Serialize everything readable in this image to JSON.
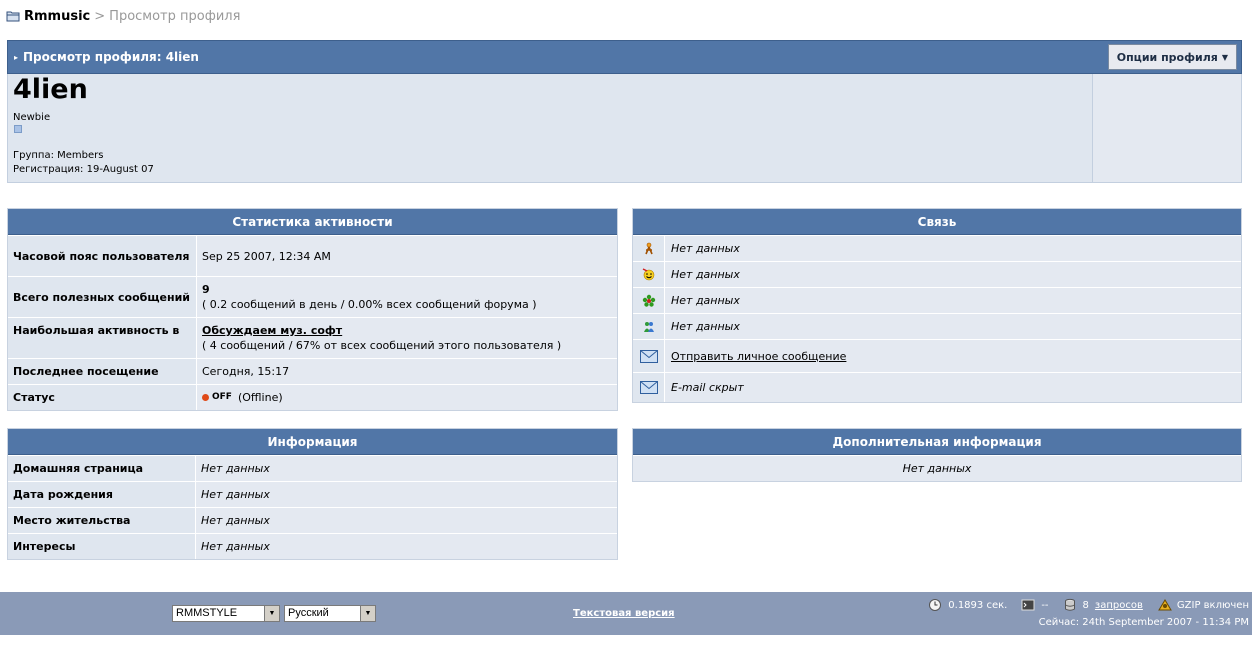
{
  "breadcrumb": {
    "home": "Rmmusic",
    "separator": ">",
    "current": "Просмотр профиля"
  },
  "header": {
    "title": "Просмотр профиля: 4lien",
    "options_label": "Опции профиля"
  },
  "profile": {
    "username": "4lien",
    "rank": "Newbie",
    "group": "Группа: Members",
    "joined": "Регистрация: 19-August 07"
  },
  "activity": {
    "title": "Статистика активности",
    "rows": [
      {
        "label": "Часовой пояс пользователя",
        "value": "Sep 25 2007, 12:34 AM"
      },
      {
        "label": "Всего полезных сообщений",
        "value": "9",
        "sub": "( 0.2 сообщений в день / 0.00% всех сообщений форума )"
      },
      {
        "label": "Наибольшая активность в",
        "value": "Обсуждаем муз. софт",
        "sub": "( 4 сообщений / 67% от всех сообщений этого пользователя )"
      },
      {
        "label": "Последнее посещение",
        "value": "Сегодня, 15:17"
      },
      {
        "label": "Статус",
        "badge": "OFF",
        "value": "(Offline)"
      }
    ]
  },
  "contact": {
    "title": "Связь",
    "rows": [
      {
        "icon": "aim-icon",
        "value": "Нет данных"
      },
      {
        "icon": "yahoo-icon",
        "value": "Нет данных"
      },
      {
        "icon": "icq-icon",
        "value": "Нет данных"
      },
      {
        "icon": "msn-icon",
        "value": "Нет данных"
      },
      {
        "icon": "envelope-icon",
        "value": "Отправить личное сообщение"
      },
      {
        "icon": "envelope-icon",
        "value": "E-mail скрыт"
      }
    ]
  },
  "info": {
    "title": "Информация",
    "rows": [
      {
        "label": "Домашняя страница",
        "value": "Нет данных"
      },
      {
        "label": "Дата рождения",
        "value": "Нет данных"
      },
      {
        "label": "Место жительства",
        "value": "Нет данных"
      },
      {
        "label": "Интересы",
        "value": "Нет данных"
      }
    ]
  },
  "extra": {
    "title": "Дополнительная информация",
    "value": "Нет данных"
  },
  "footer": {
    "skin": "RMMSTYLE",
    "language": "Русский",
    "text_version": "Текстовая версия",
    "time": "0.1893 сек.",
    "server": "--",
    "queries_count": "8",
    "queries_label": "запросов",
    "gzip": "GZIP включен",
    "now": "Сейчас: 24th September 2007 - 11:34 PM"
  },
  "colors": {
    "header_blue": "#5176a7",
    "row_label": "#dfe6ef",
    "row_value": "#e4e9f1",
    "footer": "#8a9ab7",
    "offline_red": "#e04a18"
  }
}
